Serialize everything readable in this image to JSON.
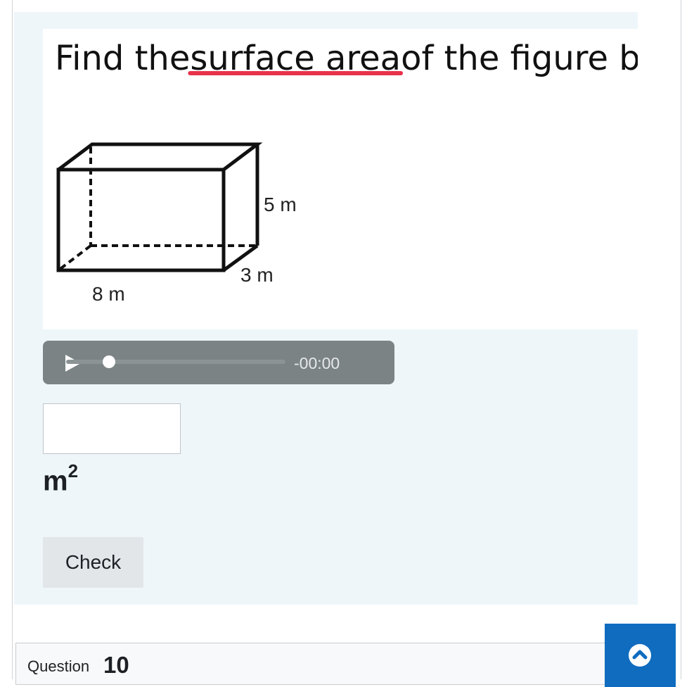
{
  "question": {
    "image_text": "Find the surface area of the figure b",
    "image_highlight": "surface area",
    "figure": {
      "height_label": "5 m",
      "depth_label": "3 m",
      "width_label": "8 m"
    },
    "highlight_color": "#e8324a"
  },
  "audio": {
    "play_icon": "play-icon",
    "time": "-00:00",
    "progress": 0
  },
  "answer": {
    "value": "",
    "placeholder": ""
  },
  "unit": {
    "base": "m",
    "exponent": "2"
  },
  "check_label": "Check",
  "next_question": {
    "label": "Question",
    "number": "10"
  },
  "back_to_top_icon": "chevron-up-icon",
  "colors": {
    "panel_bg": "#eef6fa",
    "audio_bg": "#7b8385",
    "accent_blue": "#0f6cbf"
  }
}
